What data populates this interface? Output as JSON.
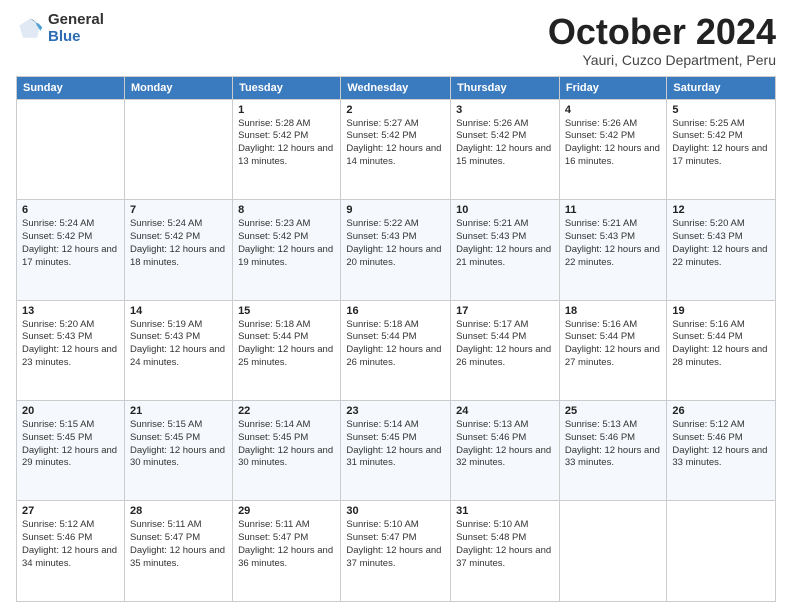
{
  "logo": {
    "general": "General",
    "blue": "Blue"
  },
  "header": {
    "month": "October 2024",
    "location": "Yauri, Cuzco Department, Peru"
  },
  "weekdays": [
    "Sunday",
    "Monday",
    "Tuesday",
    "Wednesday",
    "Thursday",
    "Friday",
    "Saturday"
  ],
  "days": [
    {
      "date": null,
      "sunrise": null,
      "sunset": null,
      "daylight": null
    },
    {
      "date": null,
      "sunrise": null,
      "sunset": null,
      "daylight": null
    },
    {
      "date": "1",
      "sunrise": "5:28 AM",
      "sunset": "5:42 PM",
      "daylight": "12 hours and 13 minutes."
    },
    {
      "date": "2",
      "sunrise": "5:27 AM",
      "sunset": "5:42 PM",
      "daylight": "12 hours and 14 minutes."
    },
    {
      "date": "3",
      "sunrise": "5:26 AM",
      "sunset": "5:42 PM",
      "daylight": "12 hours and 15 minutes."
    },
    {
      "date": "4",
      "sunrise": "5:26 AM",
      "sunset": "5:42 PM",
      "daylight": "12 hours and 16 minutes."
    },
    {
      "date": "5",
      "sunrise": "5:25 AM",
      "sunset": "5:42 PM",
      "daylight": "12 hours and 17 minutes."
    },
    {
      "date": "6",
      "sunrise": "5:24 AM",
      "sunset": "5:42 PM",
      "daylight": "12 hours and 17 minutes."
    },
    {
      "date": "7",
      "sunrise": "5:24 AM",
      "sunset": "5:42 PM",
      "daylight": "12 hours and 18 minutes."
    },
    {
      "date": "8",
      "sunrise": "5:23 AM",
      "sunset": "5:42 PM",
      "daylight": "12 hours and 19 minutes."
    },
    {
      "date": "9",
      "sunrise": "5:22 AM",
      "sunset": "5:43 PM",
      "daylight": "12 hours and 20 minutes."
    },
    {
      "date": "10",
      "sunrise": "5:21 AM",
      "sunset": "5:43 PM",
      "daylight": "12 hours and 21 minutes."
    },
    {
      "date": "11",
      "sunrise": "5:21 AM",
      "sunset": "5:43 PM",
      "daylight": "12 hours and 22 minutes."
    },
    {
      "date": "12",
      "sunrise": "5:20 AM",
      "sunset": "5:43 PM",
      "daylight": "12 hours and 22 minutes."
    },
    {
      "date": "13",
      "sunrise": "5:20 AM",
      "sunset": "5:43 PM",
      "daylight": "12 hours and 23 minutes."
    },
    {
      "date": "14",
      "sunrise": "5:19 AM",
      "sunset": "5:43 PM",
      "daylight": "12 hours and 24 minutes."
    },
    {
      "date": "15",
      "sunrise": "5:18 AM",
      "sunset": "5:44 PM",
      "daylight": "12 hours and 25 minutes."
    },
    {
      "date": "16",
      "sunrise": "5:18 AM",
      "sunset": "5:44 PM",
      "daylight": "12 hours and 26 minutes."
    },
    {
      "date": "17",
      "sunrise": "5:17 AM",
      "sunset": "5:44 PM",
      "daylight": "12 hours and 26 minutes."
    },
    {
      "date": "18",
      "sunrise": "5:16 AM",
      "sunset": "5:44 PM",
      "daylight": "12 hours and 27 minutes."
    },
    {
      "date": "19",
      "sunrise": "5:16 AM",
      "sunset": "5:44 PM",
      "daylight": "12 hours and 28 minutes."
    },
    {
      "date": "20",
      "sunrise": "5:15 AM",
      "sunset": "5:45 PM",
      "daylight": "12 hours and 29 minutes."
    },
    {
      "date": "21",
      "sunrise": "5:15 AM",
      "sunset": "5:45 PM",
      "daylight": "12 hours and 30 minutes."
    },
    {
      "date": "22",
      "sunrise": "5:14 AM",
      "sunset": "5:45 PM",
      "daylight": "12 hours and 30 minutes."
    },
    {
      "date": "23",
      "sunrise": "5:14 AM",
      "sunset": "5:45 PM",
      "daylight": "12 hours and 31 minutes."
    },
    {
      "date": "24",
      "sunrise": "5:13 AM",
      "sunset": "5:46 PM",
      "daylight": "12 hours and 32 minutes."
    },
    {
      "date": "25",
      "sunrise": "5:13 AM",
      "sunset": "5:46 PM",
      "daylight": "12 hours and 33 minutes."
    },
    {
      "date": "26",
      "sunrise": "5:12 AM",
      "sunset": "5:46 PM",
      "daylight": "12 hours and 33 minutes."
    },
    {
      "date": "27",
      "sunrise": "5:12 AM",
      "sunset": "5:46 PM",
      "daylight": "12 hours and 34 minutes."
    },
    {
      "date": "28",
      "sunrise": "5:11 AM",
      "sunset": "5:47 PM",
      "daylight": "12 hours and 35 minutes."
    },
    {
      "date": "29",
      "sunrise": "5:11 AM",
      "sunset": "5:47 PM",
      "daylight": "12 hours and 36 minutes."
    },
    {
      "date": "30",
      "sunrise": "5:10 AM",
      "sunset": "5:47 PM",
      "daylight": "12 hours and 37 minutes."
    },
    {
      "date": "31",
      "sunrise": "5:10 AM",
      "sunset": "5:48 PM",
      "daylight": "12 hours and 37 minutes."
    },
    {
      "date": null,
      "sunrise": null,
      "sunset": null,
      "daylight": null
    },
    {
      "date": null,
      "sunrise": null,
      "sunset": null,
      "daylight": null
    }
  ],
  "labels": {
    "sunrise": "Sunrise:",
    "sunset": "Sunset:",
    "daylight": "Daylight:"
  }
}
